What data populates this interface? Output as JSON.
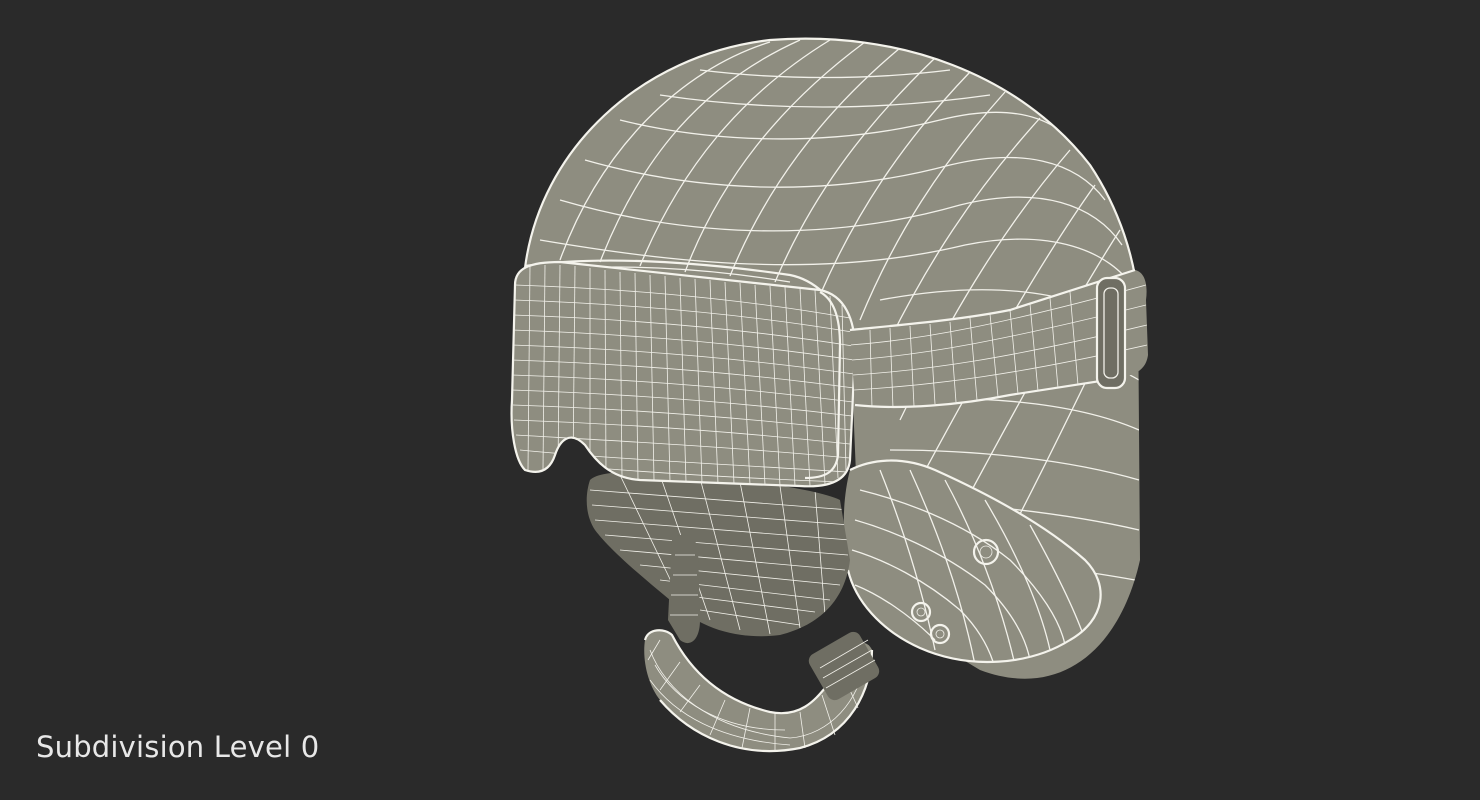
{
  "scene": {
    "caption": "Subdivision Level 0",
    "background_color": "#2a2a2a",
    "model_color": "#8e8d80",
    "wire_color": "#f2f1ea",
    "subject": "ski-helmet-with-goggles-wireframe"
  }
}
